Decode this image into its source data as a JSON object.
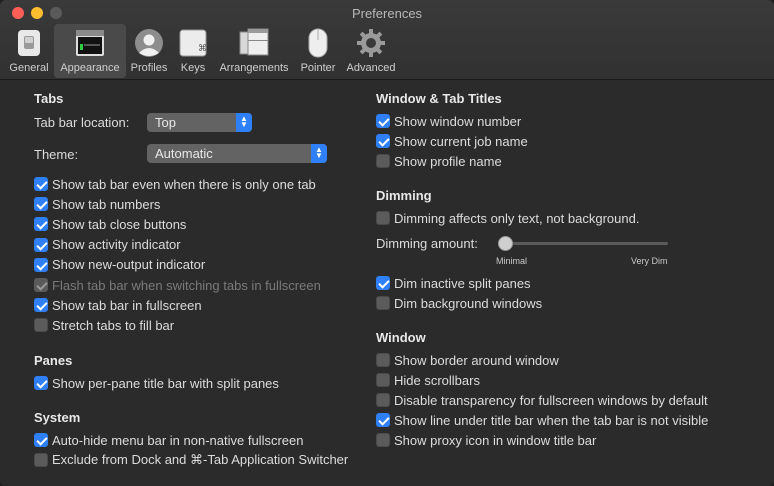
{
  "window": {
    "title": "Preferences"
  },
  "toolbar": {
    "tabs": [
      {
        "label": "General",
        "icon": "switch-icon"
      },
      {
        "label": "Appearance",
        "icon": "terminal-window-icon",
        "active": true
      },
      {
        "label": "Profiles",
        "icon": "person-icon"
      },
      {
        "label": "Keys",
        "icon": "keyboard-key-icon"
      },
      {
        "label": "Arrangements",
        "icon": "window-arrangement-icon"
      },
      {
        "label": "Pointer",
        "icon": "mouse-icon"
      },
      {
        "label": "Advanced",
        "icon": "gear-icon"
      }
    ]
  },
  "tabs_section": {
    "heading": "Tabs",
    "location_label": "Tab bar location:",
    "location_value": "Top",
    "theme_label": "Theme:",
    "theme_value": "Automatic",
    "options": [
      {
        "label": "Show tab bar even when there is only one tab",
        "checked": true
      },
      {
        "label": "Show tab numbers",
        "checked": true
      },
      {
        "label": "Show tab close buttons",
        "checked": true
      },
      {
        "label": "Show activity indicator",
        "checked": true
      },
      {
        "label": "Show new-output indicator",
        "checked": true
      },
      {
        "label": "Flash tab bar when switching tabs in fullscreen",
        "checked": true,
        "disabled": true
      },
      {
        "label": "Show tab bar in fullscreen",
        "checked": true
      },
      {
        "label": "Stretch tabs to fill bar",
        "checked": false
      }
    ]
  },
  "panes_section": {
    "heading": "Panes",
    "options": [
      {
        "label": "Show per-pane title bar with split panes",
        "checked": true
      }
    ]
  },
  "system_section": {
    "heading": "System",
    "options": [
      {
        "label": "Auto-hide menu bar in non-native fullscreen",
        "checked": true
      },
      {
        "label": "Exclude from Dock and ⌘-Tab Application Switcher",
        "checked": false
      }
    ]
  },
  "titles_section": {
    "heading": "Window & Tab Titles",
    "options": [
      {
        "label": "Show window number",
        "checked": true
      },
      {
        "label": "Show current job name",
        "checked": true
      },
      {
        "label": "Show profile name",
        "checked": false
      }
    ]
  },
  "dimming_section": {
    "heading": "Dimming",
    "options_top": [
      {
        "label": "Dimming affects only text, not background.",
        "checked": false
      }
    ],
    "amount_label": "Dimming amount:",
    "amount_value": 0,
    "min_label": "Minimal",
    "max_label": "Very Dim",
    "options_bottom": [
      {
        "label": "Dim inactive split panes",
        "checked": true
      },
      {
        "label": "Dim background windows",
        "checked": false
      }
    ]
  },
  "window_section": {
    "heading": "Window",
    "options": [
      {
        "label": "Show border around window",
        "checked": false
      },
      {
        "label": "Hide scrollbars",
        "checked": false
      },
      {
        "label": "Disable transparency for fullscreen windows by default",
        "checked": false
      },
      {
        "label": "Show line under title bar when the tab bar is not visible",
        "checked": true
      },
      {
        "label": "Show proxy icon in window title bar",
        "checked": false
      }
    ]
  },
  "colors": {
    "accent": "#2f7ff6",
    "background": "#2b2b2b",
    "close": "#ff5f57",
    "minimize": "#febc2e"
  }
}
